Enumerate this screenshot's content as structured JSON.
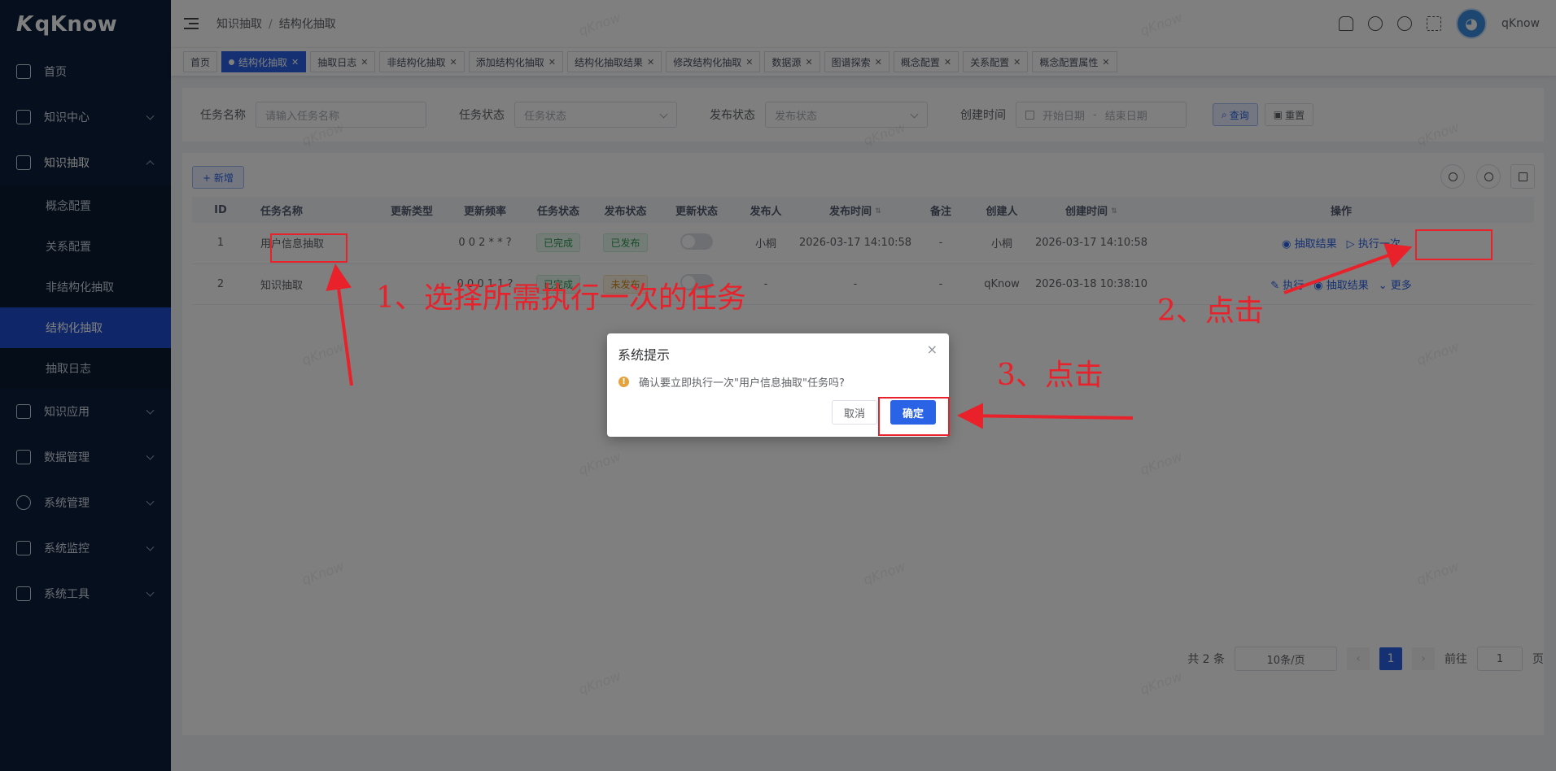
{
  "app": {
    "logo_text": "qKnow",
    "logo_mark": "K"
  },
  "sidebar": {
    "items": [
      {
        "label": "首页",
        "icon": "home-icon"
      },
      {
        "label": "知识中心",
        "icon": "doc-icon"
      },
      {
        "label": "知识抽取",
        "icon": "extract-icon"
      },
      {
        "label": "知识应用",
        "icon": "app-icon"
      },
      {
        "label": "数据管理",
        "icon": "database-icon"
      },
      {
        "label": "系统管理",
        "icon": "gear-icon"
      },
      {
        "label": "系统监控",
        "icon": "monitor-icon"
      },
      {
        "label": "系统工具",
        "icon": "tools-icon"
      }
    ],
    "sub_items": [
      "概念配置",
      "关系配置",
      "非结构化抽取",
      "结构化抽取",
      "抽取日志"
    ]
  },
  "header": {
    "breadcrumb": [
      "知识抽取",
      "结构化抽取"
    ],
    "breadcrumb_sep": "/",
    "user": "qKnow"
  },
  "tabs": [
    "首页",
    "结构化抽取",
    "抽取日志",
    "非结构化抽取",
    "添加结构化抽取",
    "结构化抽取结果",
    "修改结构化抽取",
    "数据源",
    "图谱探索",
    "概念配置",
    "关系配置",
    "概念配置属性"
  ],
  "search": {
    "task_name_label": "任务名称",
    "task_name_placeholder": "请输入任务名称",
    "task_status_label": "任务状态",
    "task_status_placeholder": "任务状态",
    "publish_status_label": "发布状态",
    "publish_status_placeholder": "发布状态",
    "created_label": "创建时间",
    "start_placeholder": "开始日期",
    "range_sep": "-",
    "end_placeholder": "结束日期",
    "query_label": "查询",
    "reset_label": "重置"
  },
  "table": {
    "add_label": "+ 新增",
    "columns": [
      "ID",
      "任务名称",
      "更新类型",
      "更新频率",
      "任务状态",
      "发布状态",
      "更新状态",
      "发布人",
      "发布时间",
      "备注",
      "创建人",
      "创建时间",
      "操作"
    ],
    "rows": [
      {
        "id": "1",
        "name": "用户信息抽取",
        "type": "",
        "freq": "0 0 2 * * ?",
        "task_status": "已完成",
        "publish_status": "已发布",
        "publisher": "小桐",
        "publish_time": "2026-03-17 14:10:58",
        "remark": "-",
        "creator": "小桐",
        "created": "2026-03-17 14:10:58",
        "ops": [
          "抽取结果",
          "执行一次"
        ]
      },
      {
        "id": "2",
        "name": "知识抽取",
        "type": "",
        "freq": "0 0 0 1 1 ?",
        "task_status": "已完成",
        "publish_status": "未发布",
        "publisher": "-",
        "publish_time": "-",
        "remark": "-",
        "creator": "qKnow",
        "created": "2026-03-18 10:38:10",
        "ops": [
          "执行",
          "抽取结果",
          "更多"
        ]
      }
    ]
  },
  "pager": {
    "total": "共 2 条",
    "size": "10条/页",
    "page": "1",
    "goto_label": "前往",
    "goto_value": "1",
    "page_unit": "页"
  },
  "dialog": {
    "title": "系统提示",
    "close": "×",
    "message": "确认要立即执行一次\"用户信息抽取\"任务吗?",
    "cancel": "取消",
    "ok": "确定"
  },
  "annotations": {
    "a1": "1、选择所需执行一次的任务",
    "a2": "2、点击",
    "a3": "3、点击"
  },
  "watermark_text": "qKnow",
  "colors": {
    "primary": "#2b63e6",
    "sidebar": "#0b1f3a",
    "annotation": "#e8212a"
  }
}
